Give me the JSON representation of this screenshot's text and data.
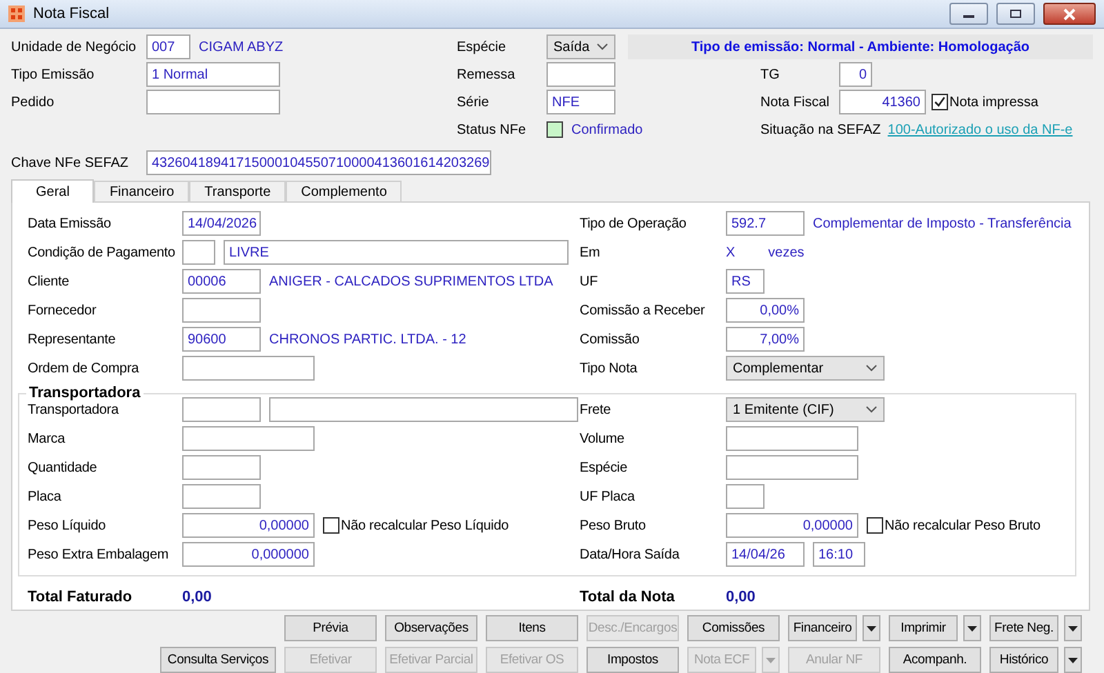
{
  "window": {
    "title": "Nota Fiscal"
  },
  "header": {
    "business_unit": {
      "label": "Unidade de Negócio",
      "code": "007",
      "name": "CIGAM ABYZ"
    },
    "species": {
      "label": "Espécie",
      "value": "Saída"
    },
    "banner": "Tipo de emissão: Normal - Ambiente: Homologação",
    "emission_type": {
      "label": "Tipo Emissão",
      "value": "1 Normal"
    },
    "shipment": {
      "label": "Remessa"
    },
    "tg": {
      "label": "TG",
      "value": "0"
    },
    "order": {
      "label": "Pedido"
    },
    "series": {
      "label": "Série",
      "value": "NFE"
    },
    "invoice": {
      "label": "Nota Fiscal",
      "value": "41360",
      "printed": {
        "label": "Nota impressa",
        "checked": true
      }
    },
    "status": {
      "label": "Status NFe",
      "color": "#c8f5c8",
      "value": "Confirmado"
    },
    "sefaz": {
      "label": "Situação na SEFAZ",
      "link": "100-Autorizado o uso da NF-e"
    },
    "key": {
      "label": "Chave NFe SEFAZ",
      "value": "43260418941715000104550710000413601614203269"
    }
  },
  "tabs": [
    {
      "label": "Geral",
      "selected": true
    },
    {
      "label": "Financeiro",
      "selected": false
    },
    {
      "label": "Transporte",
      "selected": false
    },
    {
      "label": "Complemento",
      "selected": false
    }
  ],
  "geral": {
    "left": [
      {
        "label": "Data Emissão",
        "kind": "text",
        "value": "14/04/2026"
      },
      {
        "label": "Condição de Pagamento",
        "kind": "code_name",
        "name": "LIVRE"
      },
      {
        "label": "Cliente",
        "kind": "code_desc",
        "code": "00006",
        "text": "ANIGER - CALCADOS SUPRIMENTOS LTDA"
      },
      {
        "label": "Fornecedor",
        "kind": "text"
      },
      {
        "label": "Representante",
        "kind": "code_desc",
        "code": "90600",
        "text": "CHRONOS PARTIC. LTDA. - 12"
      },
      {
        "label": "Ordem de Compra",
        "kind": "text"
      }
    ],
    "right": [
      {
        "label": "Tipo de Operação",
        "kind": "code_desc",
        "code": "592.7",
        "text": "Complementar de Imposto - Transferência"
      },
      {
        "label": "Em",
        "kind": "installments",
        "count": "X",
        "unit": "vezes"
      },
      {
        "label": "UF",
        "kind": "text",
        "value": "RS"
      },
      {
        "label": "Comissão a Receber",
        "kind": "number",
        "value": "0,00%"
      },
      {
        "label": "Comissão",
        "kind": "number",
        "value": "7,00%"
      },
      {
        "label": "Tipo Nota",
        "kind": "select",
        "value": "Complementar"
      }
    ],
    "transport": {
      "title": "Transportadora",
      "left": [
        {
          "label": "Transportadora",
          "kind": "code_name"
        },
        {
          "label": "Marca",
          "kind": "text"
        },
        {
          "label": "Quantidade",
          "kind": "text"
        },
        {
          "label": "Placa",
          "kind": "text"
        },
        {
          "label": "Peso Líquido",
          "kind": "number_checkbox",
          "value": "0,00000",
          "checkbox": {
            "label": "Não recalcular Peso Líquido",
            "checked": false
          }
        },
        {
          "label": "Peso Extra Embalagem",
          "kind": "number",
          "value": "0,000000"
        }
      ],
      "right": [
        {
          "label": "Frete",
          "kind": "select",
          "value": "1 Emitente (CIF)"
        },
        {
          "label": "Volume",
          "kind": "text"
        },
        {
          "label": "Espécie",
          "kind": "text"
        },
        {
          "label": "UF Placa",
          "kind": "text"
        },
        {
          "label": "Peso Bruto",
          "kind": "number_checkbox",
          "value": "0,00000",
          "checkbox": {
            "label": "Não recalcular Peso Bruto",
            "checked": false
          }
        },
        {
          "label": "Data/Hora Saída",
          "kind": "date_time",
          "date": "14/04/26",
          "time": "16:10"
        }
      ]
    },
    "totals": [
      {
        "label": "Total Faturado",
        "value": "0,00"
      },
      {
        "label": "Total da Nota",
        "value": "0,00"
      }
    ]
  },
  "button_rows": [
    [
      {
        "label": "Prévia",
        "disabled": false,
        "dropdown": false
      },
      {
        "label": "Observações",
        "disabled": false,
        "dropdown": false
      },
      {
        "label": "Itens",
        "disabled": false,
        "dropdown": false
      },
      {
        "label": "Desc./Encargos",
        "disabled": true,
        "dropdown": false
      },
      {
        "label": "Comissões",
        "disabled": false,
        "dropdown": false
      },
      {
        "label": "Financeiro",
        "disabled": false,
        "dropdown": true
      },
      {
        "label": "Imprimir",
        "disabled": false,
        "dropdown": true
      },
      {
        "label": "Frete Neg.",
        "disabled": false,
        "dropdown": true
      }
    ],
    [
      {
        "label": "Consulta Serviços",
        "disabled": false,
        "dropdown": false
      },
      {
        "label": "Efetivar",
        "disabled": true,
        "dropdown": false
      },
      {
        "label": "Efetivar Parcial",
        "disabled": true,
        "dropdown": false
      },
      {
        "label": "Efetivar OS",
        "disabled": true,
        "dropdown": false
      },
      {
        "label": "Impostos",
        "disabled": false,
        "dropdown": false
      },
      {
        "label": "Nota ECF",
        "disabled": true,
        "dropdown": true
      },
      {
        "label": "Anular NF",
        "disabled": true,
        "dropdown": false
      },
      {
        "label": "Acompanh.",
        "disabled": false,
        "dropdown": false
      },
      {
        "label": "Histórico",
        "disabled": false,
        "dropdown": true
      }
    ]
  ]
}
